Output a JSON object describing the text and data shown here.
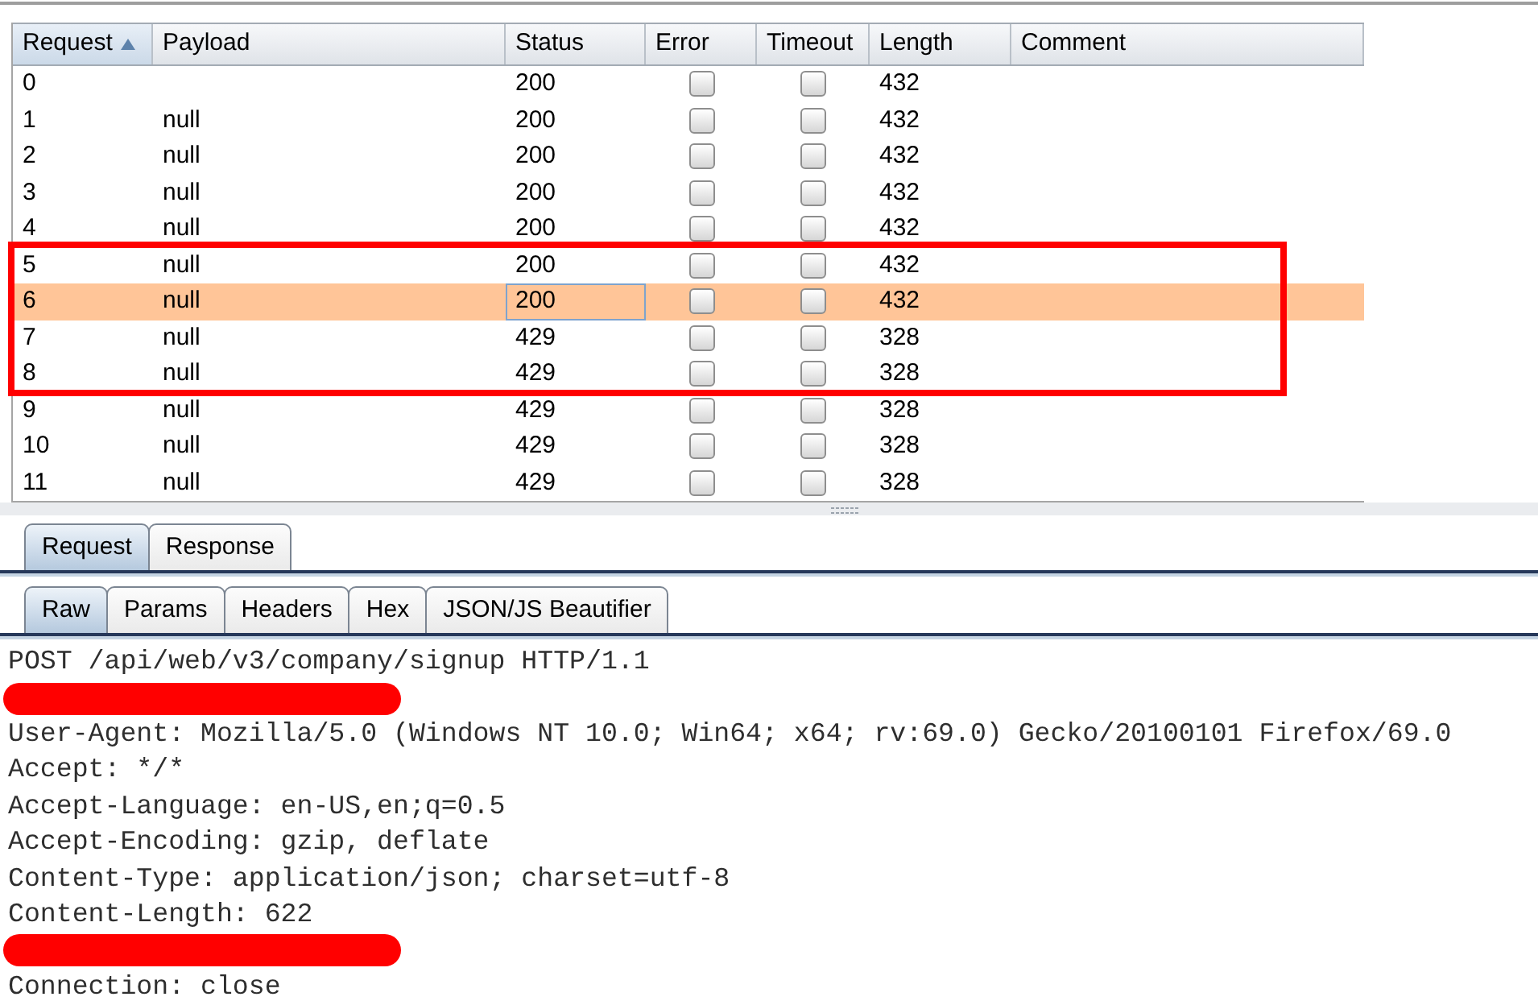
{
  "table": {
    "columns": [
      {
        "label": "Request",
        "kind": "text",
        "sorted": true,
        "focused": false
      },
      {
        "label": "Payload",
        "kind": "text",
        "sorted": false,
        "focused": false
      },
      {
        "label": "Status",
        "kind": "text",
        "sorted": false,
        "focused": true
      },
      {
        "label": "Error",
        "kind": "checkbox",
        "sorted": false,
        "focused": false
      },
      {
        "label": "Timeout",
        "kind": "checkbox",
        "sorted": false,
        "focused": false
      },
      {
        "label": "Length",
        "kind": "text",
        "sorted": false,
        "focused": false
      },
      {
        "label": "Comment",
        "kind": "text",
        "sorted": false,
        "focused": false
      }
    ],
    "rows": [
      {
        "request": "0",
        "status": "200",
        "error": false,
        "timeout": false,
        "length": "432",
        "selected": false,
        "focused": false
      },
      {
        "request": "1",
        "payload": "null",
        "status": "200",
        "error": false,
        "timeout": false,
        "length": "432",
        "selected": false,
        "focused": false
      },
      {
        "request": "2",
        "payload": "null",
        "status": "200",
        "error": false,
        "timeout": false,
        "length": "432",
        "selected": false,
        "focused": false
      },
      {
        "request": "3",
        "payload": "null",
        "status": "200",
        "error": false,
        "timeout": false,
        "length": "432",
        "selected": false,
        "focused": false
      },
      {
        "request": "4",
        "payload": "null",
        "status": "200",
        "error": false,
        "timeout": false,
        "length": "432",
        "selected": false,
        "focused": false
      },
      {
        "request": "5",
        "payload": "null",
        "status": "200",
        "error": false,
        "timeout": false,
        "length": "432",
        "selected": false,
        "focused": false
      },
      {
        "request": "6",
        "payload": "null",
        "status": "200",
        "error": false,
        "timeout": false,
        "length": "432",
        "selected": true,
        "focused": true
      },
      {
        "request": "7",
        "payload": "null",
        "status": "429",
        "error": false,
        "timeout": false,
        "length": "328",
        "selected": false,
        "focused": false
      },
      {
        "request": "8",
        "payload": "null",
        "status": "429",
        "error": false,
        "timeout": false,
        "length": "328",
        "selected": false,
        "focused": false
      },
      {
        "request": "9",
        "payload": "null",
        "status": "429",
        "error": false,
        "timeout": false,
        "length": "328",
        "selected": false,
        "focused": false
      },
      {
        "request": "10",
        "payload": "null",
        "status": "429",
        "error": false,
        "timeout": false,
        "length": "328",
        "selected": false,
        "focused": false
      },
      {
        "request": "11",
        "payload": "null",
        "status": "429",
        "error": false,
        "timeout": false,
        "length": "328",
        "selected": false,
        "focused": false
      }
    ]
  },
  "tabs": [
    {
      "label": "Request",
      "selected": true
    },
    {
      "label": "Response",
      "selected": false
    }
  ],
  "subtabs": [
    {
      "label": "Raw",
      "selected": true
    },
    {
      "label": "Params",
      "selected": false
    },
    {
      "label": "Headers",
      "selected": false
    },
    {
      "label": "Hex",
      "selected": false
    },
    {
      "label": "JSON/JS Beautifier",
      "selected": false
    }
  ],
  "message": {
    "lines": [
      {
        "kind": "text",
        "text": "POST /api/web/v3/company/signup HTTP/1.1"
      },
      {
        "kind": "redacted"
      },
      {
        "kind": "text",
        "text": "User-Agent: Mozilla/5.0 (Windows NT 10.0; Win64; x64; rv:69.0) Gecko/20100101 Firefox/69.0"
      },
      {
        "kind": "text",
        "text": "Accept: */*"
      },
      {
        "kind": "text",
        "text": "Accept-Language: en-US,en;q=0.5"
      },
      {
        "kind": "text",
        "text": "Accept-Encoding: gzip, deflate"
      },
      {
        "kind": "text",
        "text": "Content-Type: application/json; charset=utf-8"
      },
      {
        "kind": "text",
        "text": "Content-Length: 622"
      },
      {
        "kind": "redacted"
      },
      {
        "kind": "text",
        "text": "Connection: close"
      }
    ]
  }
}
